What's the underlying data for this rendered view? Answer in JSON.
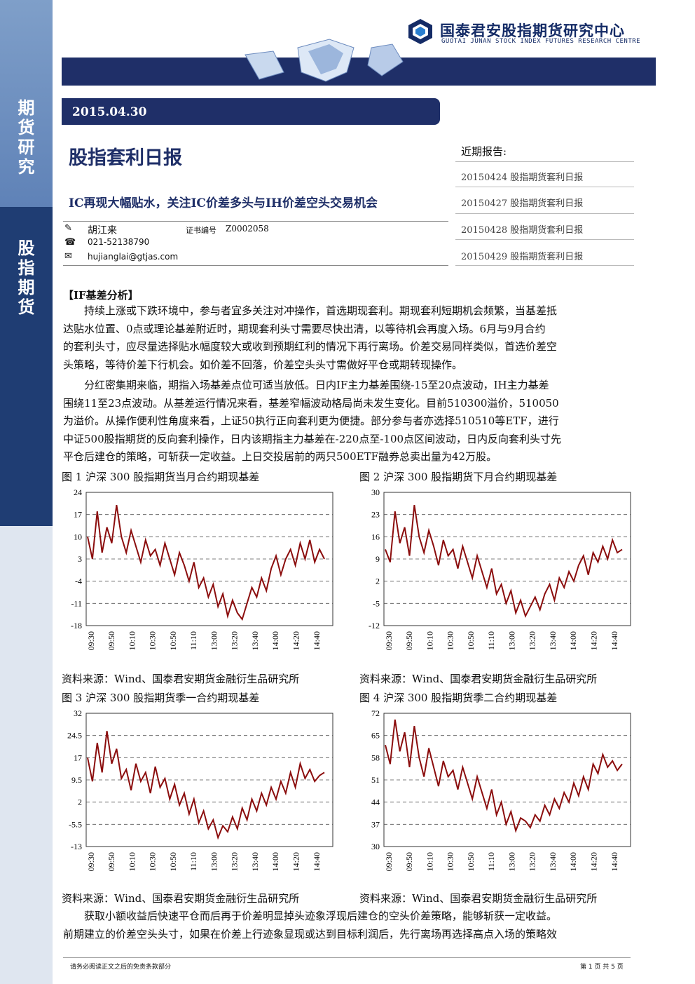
{
  "sidebar": {
    "top_label": [
      "期",
      "货",
      "研",
      "究"
    ],
    "bottom_label": [
      "股",
      "指",
      "期",
      "货"
    ]
  },
  "header": {
    "brand_cn": "国泰君安股指期货研究中心",
    "brand_en": "GUOTAI JUNAN STOCK INDEX FUTURES RESEARCH CENTRE"
  },
  "report": {
    "date": "2015.04.30",
    "title": "股指套利日报",
    "subtitle": "IC再现大幅贴水，关注IC价差多头与IH价差空头交易机会"
  },
  "author": {
    "name": "胡江来",
    "cert_label": "证书编号",
    "cert_no": "Z0002058",
    "phone": "021-52138790",
    "email": "hujianglai@gtjas.com"
  },
  "recent": {
    "heading": "近期报告:",
    "items": [
      "20150424 股指期货套利日报",
      "20150427 股指期货套利日报",
      "20150428 股指期货套利日报",
      "20150429 股指期货套利日报"
    ]
  },
  "section_title": "【IF基差分析】",
  "para1": [
    "　　持续上涨或下跌环境中，参与者宜多关注对冲操作，首选期现套利。期现套利短期机会频繁，当基差抵",
    "达贴水位置、0点或理论基差附近时，期现套利头寸需要尽快出清，以等待机会再度入场。6月与9月合约",
    "的套利头寸，应尽量选择贴水幅度较大或收到预期红利的情况下再行离场。价差交易同样类似，首选价差空",
    "头策略，等待价差下行机会。如价差不回落，价差空头头寸需做好平仓或期转现操作。"
  ],
  "para2": [
    "　　分红密集期来临，期指入场基差点位可适当放低。日内IF主力基差围绕-15至20点波动，IH主力基差",
    "围绕11至23点波动。从基差运行情况来看，基差窄幅波动格局尚未发生变化。目前510300溢价，510050",
    "为溢价。从操作便利性角度来看，上证50执行正向套利更为便捷。部分参与者亦选择510510等ETF，进行",
    "中证500股指期货的反向套利操作，日内该期指主力基差在-220点至-100点区间波动，日内反向套利头寸先",
    "平仓后建仓的策略，可斩获一定收益。上日交投居前的两只500ETF融券总卖出量为42万股。"
  ],
  "para3": [
    "　　获取小额收益后快速平仓而后再于价差明显掉头迹象浮现后建仓的空头价差策略，能够斩获一定收益。",
    "前期建立的价差空头头寸，如果在价差上行迹象显现或达到目标利润后，先行离场再选择高点入场的策略效"
  ],
  "source": "资料来源：Wind、国泰君安期货金融衍生品研究所",
  "footer": {
    "left": "请务必阅读正文之后的免责条款部分",
    "right": "第 1 页 共 5 页"
  },
  "colors": {
    "navy": "#1f2f68",
    "line": "#8b0d0d"
  },
  "chart_data": [
    {
      "type": "line",
      "title": "图 1 沪深 300 股指期货当月合约期现基差",
      "yticks": [
        "24",
        "17",
        "10",
        "3",
        "-4",
        "-11",
        "-18"
      ],
      "ylim": [
        -18,
        24
      ],
      "categories": [
        "09:30",
        "09:50",
        "10:10",
        "10:30",
        "10:50",
        "11:10",
        "13:00",
        "13:20",
        "13:40",
        "14:00",
        "14:20",
        "14:40"
      ],
      "values": [
        10,
        3,
        18,
        5,
        13,
        8,
        20,
        10,
        5,
        12,
        7,
        2,
        9,
        4,
        6,
        1,
        8,
        3,
        -2,
        5,
        1,
        -4,
        2,
        -6,
        -3,
        -9,
        -5,
        -12,
        -8,
        -15,
        -10,
        -14,
        -16,
        -11,
        -6,
        -9,
        -3,
        -7,
        0,
        4,
        -2,
        3,
        6,
        1,
        8,
        3,
        9,
        2,
        6,
        3
      ]
    },
    {
      "type": "line",
      "title": "图 2 沪深 300 股指期货下月合约期现基差",
      "yticks": [
        "30",
        "23",
        "16",
        "9",
        "2",
        "-5",
        "-12"
      ],
      "ylim": [
        -12,
        30
      ],
      "categories": [
        "09:30",
        "09:50",
        "10:10",
        "10:30",
        "10:50",
        "11:10",
        "13:00",
        "13:20",
        "13:40",
        "14:00",
        "14:20",
        "14:40"
      ],
      "values": [
        12,
        8,
        24,
        14,
        19,
        10,
        26,
        16,
        11,
        18,
        13,
        7,
        15,
        10,
        12,
        6,
        13,
        8,
        3,
        10,
        5,
        0,
        6,
        -2,
        1,
        -5,
        -1,
        -8,
        -4,
        -9,
        -6,
        -3,
        -7,
        -2,
        1,
        -4,
        3,
        0,
        5,
        2,
        7,
        10,
        4,
        11,
        8,
        13,
        9,
        15,
        11,
        12
      ]
    },
    {
      "type": "line",
      "title": "图 3 沪深 300 股指期货季一合约期现基差",
      "yticks": [
        "32",
        "24.5",
        "17",
        "9.5",
        "2",
        "-5.5",
        "-13"
      ],
      "ylim": [
        -13,
        32
      ],
      "categories": [
        "09:30",
        "09:50",
        "10:10",
        "10:30",
        "10:50",
        "11:10",
        "13:00",
        "13:20",
        "13:40",
        "14:00",
        "14:20",
        "14:40"
      ],
      "values": [
        17,
        9,
        22,
        12,
        26,
        15,
        20,
        10,
        13,
        6,
        15,
        9,
        12,
        5,
        14,
        7,
        10,
        3,
        8,
        1,
        5,
        -2,
        3,
        -5,
        -1,
        -7,
        -4,
        -10,
        -6,
        -8,
        -3,
        -7,
        0,
        -4,
        3,
        -1,
        5,
        1,
        7,
        3,
        9,
        5,
        12,
        7,
        15,
        10,
        13,
        9,
        11,
        12
      ]
    },
    {
      "type": "line",
      "title": "图 4 沪深 300 股指期货季二合约期现基差",
      "yticks": [
        "72",
        "65",
        "58",
        "51",
        "44",
        "37",
        "30"
      ],
      "ylim": [
        30,
        72
      ],
      "categories": [
        "09:30",
        "09:50",
        "10:10",
        "10:30",
        "10:50",
        "11:10",
        "13:00",
        "13:20",
        "13:40",
        "14:00",
        "14:20",
        "14:40"
      ],
      "values": [
        62,
        56,
        70,
        60,
        66,
        55,
        68,
        58,
        52,
        61,
        55,
        49,
        57,
        52,
        54,
        48,
        55,
        50,
        45,
        52,
        47,
        42,
        48,
        40,
        44,
        37,
        41,
        35,
        39,
        38,
        36,
        40,
        38,
        43,
        40,
        45,
        42,
        47,
        44,
        50,
        46,
        52,
        48,
        56,
        53,
        59,
        55,
        57,
        54,
        56
      ]
    }
  ]
}
